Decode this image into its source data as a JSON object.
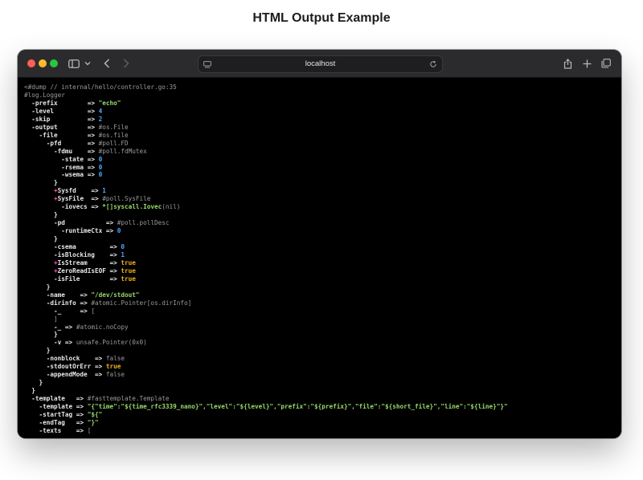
{
  "page": {
    "heading": "HTML Output Example"
  },
  "browser": {
    "url": "localhost",
    "icons": {
      "close": "close-icon",
      "minimize": "minimize-icon",
      "zoom": "zoom-icon",
      "sidebar": "sidebar-icon",
      "chevron": "chevron-down-icon",
      "back": "back-arrow-icon",
      "forward": "forward-arrow-icon",
      "page": "page-icon",
      "reload": "reload-icon",
      "share": "share-icon",
      "new_tab": "plus-icon",
      "tab_overview": "tabs-overview-icon"
    }
  },
  "colors": {
    "comment": "#9a9a9a",
    "string": "#9ad86b",
    "number": "#4aa8ff",
    "bool": "#f0b020",
    "exported_marker": "#ff5db1",
    "background": "#000000"
  },
  "dump_lines": [
    [
      {
        "c": "<#dump // internal/hello/controller.go:35",
        "k": "c"
      }
    ],
    [
      {
        "c": "#log.Logger",
        "k": "t"
      }
    ],
    [
      {
        "c": "  -prefix        ",
        "k": "k"
      },
      {
        "c": "=> ",
        "k": "o"
      },
      {
        "c": "\"echo\"",
        "k": "s"
      }
    ],
    [
      {
        "c": "  -level         ",
        "k": "k"
      },
      {
        "c": "=> ",
        "k": "o"
      },
      {
        "c": "4",
        "k": "n"
      }
    ],
    [
      {
        "c": "  -skip          ",
        "k": "k"
      },
      {
        "c": "=> ",
        "k": "o"
      },
      {
        "c": "2",
        "k": "n"
      }
    ],
    [
      {
        "c": "  -output        ",
        "k": "k"
      },
      {
        "c": "=> ",
        "k": "o"
      },
      {
        "c": "#os.File",
        "k": "t"
      }
    ],
    [
      {
        "c": "    -file        ",
        "k": "k"
      },
      {
        "c": "=> ",
        "k": "o"
      },
      {
        "c": "#os.file",
        "k": "t"
      }
    ],
    [
      {
        "c": "      -pfd       ",
        "k": "k"
      },
      {
        "c": "=> ",
        "k": "o"
      },
      {
        "c": "#poll.FD",
        "k": "t"
      }
    ],
    [
      {
        "c": "        -fdmu    ",
        "k": "k"
      },
      {
        "c": "=> ",
        "k": "o"
      },
      {
        "c": "#poll.fdMutex",
        "k": "t"
      }
    ],
    [
      {
        "c": "          -state ",
        "k": "k"
      },
      {
        "c": "=> ",
        "k": "o"
      },
      {
        "c": "0",
        "k": "n"
      }
    ],
    [
      {
        "c": "          -rsema ",
        "k": "k"
      },
      {
        "c": "=> ",
        "k": "o"
      },
      {
        "c": "0",
        "k": "n"
      }
    ],
    [
      {
        "c": "          -wsema ",
        "k": "k"
      },
      {
        "c": "=> ",
        "k": "o"
      },
      {
        "c": "0",
        "k": "n"
      }
    ],
    [
      {
        "c": "        }",
        "k": "k"
      }
    ],
    [
      {
        "c": "        ",
        "k": "k"
      },
      {
        "c": "+",
        "k": "m"
      },
      {
        "c": "Sysfd    ",
        "k": "k"
      },
      {
        "c": "=> ",
        "k": "o"
      },
      {
        "c": "1",
        "k": "n"
      }
    ],
    [
      {
        "c": "        ",
        "k": "k"
      },
      {
        "c": "+",
        "k": "m"
      },
      {
        "c": "SysFile  ",
        "k": "k"
      },
      {
        "c": "=> ",
        "k": "o"
      },
      {
        "c": "#poll.SysFile",
        "k": "t"
      }
    ],
    [
      {
        "c": "          -iovecs ",
        "k": "k"
      },
      {
        "c": "=> ",
        "k": "o"
      },
      {
        "c": "*[]syscall.Iovec",
        "k": "g"
      },
      {
        "c": "(nil)",
        "k": "t"
      }
    ],
    [
      {
        "c": "        }",
        "k": "k"
      }
    ],
    [
      {
        "c": "        -pd           ",
        "k": "k"
      },
      {
        "c": "=> ",
        "k": "o"
      },
      {
        "c": "#poll.pollDesc",
        "k": "t"
      }
    ],
    [
      {
        "c": "          -runtimeCtx ",
        "k": "k"
      },
      {
        "c": "=> ",
        "k": "o"
      },
      {
        "c": "0",
        "k": "n"
      }
    ],
    [
      {
        "c": "        }",
        "k": "k"
      }
    ],
    [
      {
        "c": "        -csema         ",
        "k": "k"
      },
      {
        "c": "=> ",
        "k": "o"
      },
      {
        "c": "0",
        "k": "n"
      }
    ],
    [
      {
        "c": "        -isBlocking    ",
        "k": "k"
      },
      {
        "c": "=> ",
        "k": "o"
      },
      {
        "c": "1",
        "k": "n"
      }
    ],
    [
      {
        "c": "        ",
        "k": "k"
      },
      {
        "c": "+",
        "k": "m"
      },
      {
        "c": "IsStream      ",
        "k": "k"
      },
      {
        "c": "=> ",
        "k": "o"
      },
      {
        "c": "true",
        "k": "b"
      }
    ],
    [
      {
        "c": "        ",
        "k": "k"
      },
      {
        "c": "+",
        "k": "m"
      },
      {
        "c": "ZeroReadIsEOF ",
        "k": "k"
      },
      {
        "c": "=> ",
        "k": "o"
      },
      {
        "c": "true",
        "k": "b"
      }
    ],
    [
      {
        "c": "        -isFile        ",
        "k": "k"
      },
      {
        "c": "=> ",
        "k": "o"
      },
      {
        "c": "true",
        "k": "b"
      }
    ],
    [
      {
        "c": "      }",
        "k": "k"
      }
    ],
    [
      {
        "c": "      -name    ",
        "k": "k"
      },
      {
        "c": "=> ",
        "k": "o"
      },
      {
        "c": "\"/dev/stdout\"",
        "k": "s"
      }
    ],
    [
      {
        "c": "      -dirinfo ",
        "k": "k"
      },
      {
        "c": "=> ",
        "k": "o"
      },
      {
        "c": "#atomic.Pointer[os.dirInfo]",
        "k": "t"
      }
    ],
    [
      {
        "c": "        -_     ",
        "k": "k"
      },
      {
        "c": "=> ",
        "k": "o"
      },
      {
        "c": "[",
        "k": "t"
      }
    ],
    [
      {
        "c": "        ]",
        "k": "t"
      }
    ],
    [
      {
        "c": "        -_ ",
        "k": "k"
      },
      {
        "c": "=> ",
        "k": "o"
      },
      {
        "c": "#atomic.noCopy",
        "k": "t"
      }
    ],
    [
      {
        "c": "        }",
        "k": "k"
      }
    ],
    [
      {
        "c": "        -v ",
        "k": "k"
      },
      {
        "c": "=> ",
        "k": "o"
      },
      {
        "c": "unsafe.Pointer(0x0)",
        "k": "t"
      }
    ],
    [
      {
        "c": "      }",
        "k": "k"
      }
    ],
    [
      {
        "c": "      -nonblock    ",
        "k": "k"
      },
      {
        "c": "=> ",
        "k": "o"
      },
      {
        "c": "false",
        "k": "t"
      }
    ],
    [
      {
        "c": "      -stdoutOrErr ",
        "k": "k"
      },
      {
        "c": "=> ",
        "k": "o"
      },
      {
        "c": "true",
        "k": "b"
      }
    ],
    [
      {
        "c": "      -appendMode  ",
        "k": "k"
      },
      {
        "c": "=> ",
        "k": "o"
      },
      {
        "c": "false",
        "k": "t"
      }
    ],
    [
      {
        "c": "    }",
        "k": "k"
      }
    ],
    [
      {
        "c": "  }",
        "k": "k"
      }
    ],
    [
      {
        "c": "  -template   ",
        "k": "k"
      },
      {
        "c": "=> ",
        "k": "o"
      },
      {
        "c": "#fasttemplate.Template",
        "k": "t"
      }
    ],
    [
      {
        "c": "    -template ",
        "k": "k"
      },
      {
        "c": "=> ",
        "k": "o"
      },
      {
        "c": "\"{\"time\":\"${time_rfc3339_nano}\",\"level\":\"${level}\",\"prefix\":\"${prefix}\",\"file\":\"${short_file}\",\"line\":\"${line}\"}\"",
        "k": "s"
      }
    ],
    [
      {
        "c": "    -startTag ",
        "k": "k"
      },
      {
        "c": "=> ",
        "k": "o"
      },
      {
        "c": "\"${\"",
        "k": "s"
      }
    ],
    [
      {
        "c": "    -endTag   ",
        "k": "k"
      },
      {
        "c": "=> ",
        "k": "o"
      },
      {
        "c": "\"}\"",
        "k": "s"
      }
    ],
    [
      {
        "c": "    -texts    ",
        "k": "k"
      },
      {
        "c": "=> ",
        "k": "o"
      },
      {
        "c": "[",
        "k": "t"
      }
    ]
  ]
}
